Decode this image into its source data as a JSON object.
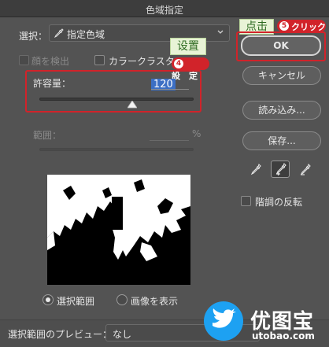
{
  "window": {
    "title": "色域指定"
  },
  "select": {
    "label": "選択：",
    "value": "指定色域"
  },
  "options": {
    "detect_faces": "顔を検出",
    "localized_clusters": "カラークラスタ"
  },
  "tolerance": {
    "label": "許容量：",
    "value": "120",
    "slider_fraction": 0.6
  },
  "range": {
    "label": "範囲：",
    "unit": "%"
  },
  "preview_mode": {
    "selection": "選択範囲",
    "image": "画像を表示"
  },
  "buttons": {
    "ok": "OK",
    "cancel": "キャンセル",
    "load": "読み込み...",
    "save": "保存..."
  },
  "invert": {
    "label": "階調の反転"
  },
  "bottom": {
    "label": "選択範囲のプレビュー：",
    "value": "なし"
  },
  "annotations": {
    "setting_tag": "设置",
    "step4_num": "4",
    "step4_label": "設　定",
    "click_tag": "点击",
    "step5_num": "5",
    "step5_label": "クリック"
  },
  "watermark": {
    "brand": "优图宝",
    "site": "utobao.com"
  },
  "colors": {
    "annotation_red": "#d1232a",
    "annotation_green_bg": "#e8f3d6",
    "highlight_blue": "#3c6fc4",
    "watermark_blue": "#1da1f2"
  }
}
